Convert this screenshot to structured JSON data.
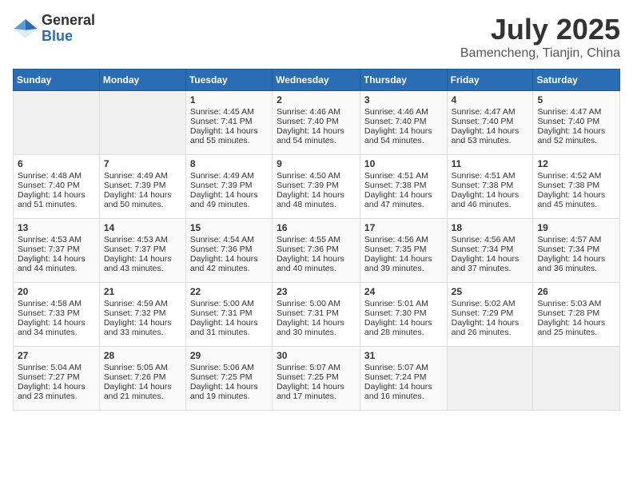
{
  "logo": {
    "general": "General",
    "blue": "Blue"
  },
  "title": {
    "month": "July 2025",
    "location": "Bamencheng, Tianjin, China"
  },
  "weekdays": [
    "Sunday",
    "Monday",
    "Tuesday",
    "Wednesday",
    "Thursday",
    "Friday",
    "Saturday"
  ],
  "weeks": [
    [
      {
        "day": "",
        "data": ""
      },
      {
        "day": "",
        "data": ""
      },
      {
        "day": "1",
        "data": "Sunrise: 4:45 AM\nSunset: 7:41 PM\nDaylight: 14 hours and 55 minutes."
      },
      {
        "day": "2",
        "data": "Sunrise: 4:46 AM\nSunset: 7:40 PM\nDaylight: 14 hours and 54 minutes."
      },
      {
        "day": "3",
        "data": "Sunrise: 4:46 AM\nSunset: 7:40 PM\nDaylight: 14 hours and 54 minutes."
      },
      {
        "day": "4",
        "data": "Sunrise: 4:47 AM\nSunset: 7:40 PM\nDaylight: 14 hours and 53 minutes."
      },
      {
        "day": "5",
        "data": "Sunrise: 4:47 AM\nSunset: 7:40 PM\nDaylight: 14 hours and 52 minutes."
      }
    ],
    [
      {
        "day": "6",
        "data": "Sunrise: 4:48 AM\nSunset: 7:40 PM\nDaylight: 14 hours and 51 minutes."
      },
      {
        "day": "7",
        "data": "Sunrise: 4:49 AM\nSunset: 7:39 PM\nDaylight: 14 hours and 50 minutes."
      },
      {
        "day": "8",
        "data": "Sunrise: 4:49 AM\nSunset: 7:39 PM\nDaylight: 14 hours and 49 minutes."
      },
      {
        "day": "9",
        "data": "Sunrise: 4:50 AM\nSunset: 7:39 PM\nDaylight: 14 hours and 48 minutes."
      },
      {
        "day": "10",
        "data": "Sunrise: 4:51 AM\nSunset: 7:38 PM\nDaylight: 14 hours and 47 minutes."
      },
      {
        "day": "11",
        "data": "Sunrise: 4:51 AM\nSunset: 7:38 PM\nDaylight: 14 hours and 46 minutes."
      },
      {
        "day": "12",
        "data": "Sunrise: 4:52 AM\nSunset: 7:38 PM\nDaylight: 14 hours and 45 minutes."
      }
    ],
    [
      {
        "day": "13",
        "data": "Sunrise: 4:53 AM\nSunset: 7:37 PM\nDaylight: 14 hours and 44 minutes."
      },
      {
        "day": "14",
        "data": "Sunrise: 4:53 AM\nSunset: 7:37 PM\nDaylight: 14 hours and 43 minutes."
      },
      {
        "day": "15",
        "data": "Sunrise: 4:54 AM\nSunset: 7:36 PM\nDaylight: 14 hours and 42 minutes."
      },
      {
        "day": "16",
        "data": "Sunrise: 4:55 AM\nSunset: 7:36 PM\nDaylight: 14 hours and 40 minutes."
      },
      {
        "day": "17",
        "data": "Sunrise: 4:56 AM\nSunset: 7:35 PM\nDaylight: 14 hours and 39 minutes."
      },
      {
        "day": "18",
        "data": "Sunrise: 4:56 AM\nSunset: 7:34 PM\nDaylight: 14 hours and 37 minutes."
      },
      {
        "day": "19",
        "data": "Sunrise: 4:57 AM\nSunset: 7:34 PM\nDaylight: 14 hours and 36 minutes."
      }
    ],
    [
      {
        "day": "20",
        "data": "Sunrise: 4:58 AM\nSunset: 7:33 PM\nDaylight: 14 hours and 34 minutes."
      },
      {
        "day": "21",
        "data": "Sunrise: 4:59 AM\nSunset: 7:32 PM\nDaylight: 14 hours and 33 minutes."
      },
      {
        "day": "22",
        "data": "Sunrise: 5:00 AM\nSunset: 7:31 PM\nDaylight: 14 hours and 31 minutes."
      },
      {
        "day": "23",
        "data": "Sunrise: 5:00 AM\nSunset: 7:31 PM\nDaylight: 14 hours and 30 minutes."
      },
      {
        "day": "24",
        "data": "Sunrise: 5:01 AM\nSunset: 7:30 PM\nDaylight: 14 hours and 28 minutes."
      },
      {
        "day": "25",
        "data": "Sunrise: 5:02 AM\nSunset: 7:29 PM\nDaylight: 14 hours and 26 minutes."
      },
      {
        "day": "26",
        "data": "Sunrise: 5:03 AM\nSunset: 7:28 PM\nDaylight: 14 hours and 25 minutes."
      }
    ],
    [
      {
        "day": "27",
        "data": "Sunrise: 5:04 AM\nSunset: 7:27 PM\nDaylight: 14 hours and 23 minutes."
      },
      {
        "day": "28",
        "data": "Sunrise: 5:05 AM\nSunset: 7:26 PM\nDaylight: 14 hours and 21 minutes."
      },
      {
        "day": "29",
        "data": "Sunrise: 5:06 AM\nSunset: 7:25 PM\nDaylight: 14 hours and 19 minutes."
      },
      {
        "day": "30",
        "data": "Sunrise: 5:07 AM\nSunset: 7:25 PM\nDaylight: 14 hours and 17 minutes."
      },
      {
        "day": "31",
        "data": "Sunrise: 5:07 AM\nSunset: 7:24 PM\nDaylight: 14 hours and 16 minutes."
      },
      {
        "day": "",
        "data": ""
      },
      {
        "day": "",
        "data": ""
      }
    ]
  ]
}
